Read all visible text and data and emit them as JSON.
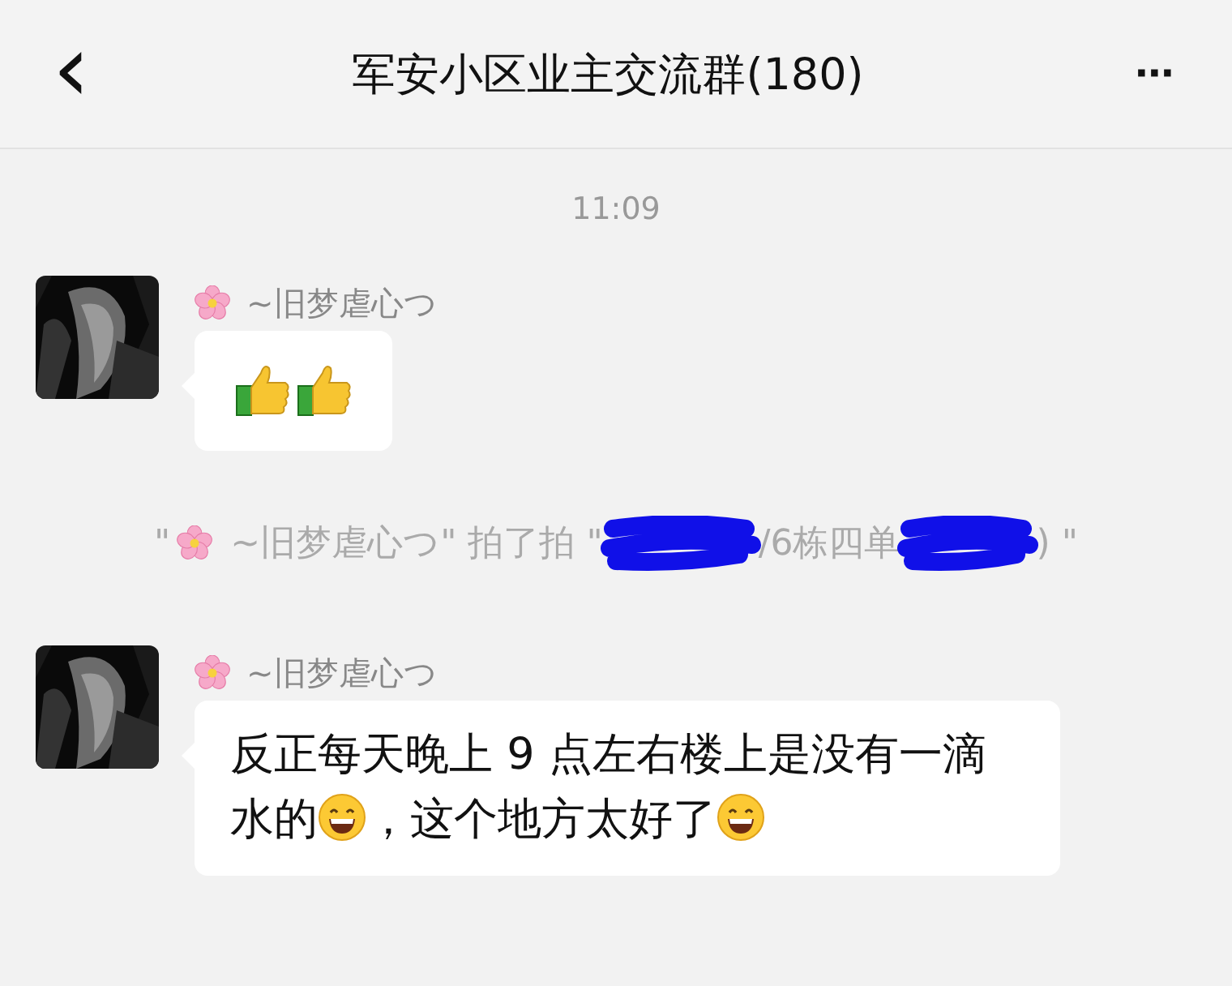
{
  "header": {
    "back_glyph": "‹",
    "title": "军安小区业主交流群(180)",
    "more_glyph": "···"
  },
  "timestamp": "11:09",
  "items": [
    {
      "kind": "message",
      "sender": "~旧梦虐心つ",
      "segments": [
        {
          "kind": "thumbs-up"
        },
        {
          "kind": "thumbs-up"
        }
      ]
    },
    {
      "kind": "system",
      "segments": [
        {
          "kind": "text",
          "text": "\""
        },
        {
          "kind": "flower"
        },
        {
          "kind": "text",
          "text": " ~旧梦虐心つ\" 拍了拍 \""
        },
        {
          "kind": "redaction"
        },
        {
          "kind": "text",
          "text": "/6栋四单"
        },
        {
          "kind": "redaction"
        },
        {
          "kind": "text",
          "text": ") \""
        }
      ]
    },
    {
      "kind": "message",
      "sender": "~旧梦虐心つ",
      "segments": [
        {
          "kind": "text",
          "text": "反正每天晚上 9 点左右楼上是没有一滴水的"
        },
        {
          "kind": "grin"
        },
        {
          "kind": "text",
          "text": "，这个地方太好了"
        },
        {
          "kind": "grin"
        }
      ]
    }
  ]
}
